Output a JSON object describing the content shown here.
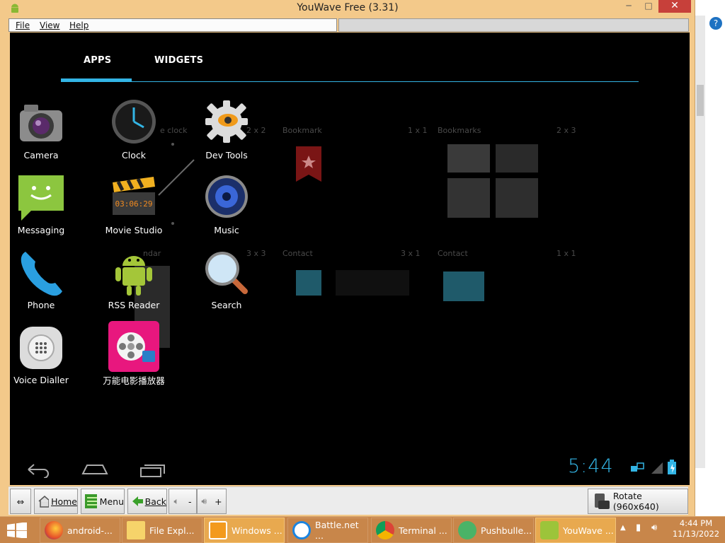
{
  "window": {
    "title": "YouWave Free (3.31)",
    "min": "─",
    "max": "□",
    "close": "✕"
  },
  "menubar": {
    "items": [
      "File",
      "View",
      "Help"
    ]
  },
  "android": {
    "tabs": [
      "APPS",
      "WIDGETS"
    ],
    "apps": [
      {
        "label": "Camera",
        "icon": "camera-icon"
      },
      {
        "label": "Clock",
        "icon": "clock-icon"
      },
      {
        "label": "Dev Tools",
        "icon": "dev-tools-icon"
      },
      {
        "label": "Messaging",
        "icon": "messaging-icon"
      },
      {
        "label": "Movie Studio",
        "icon": "movie-studio-icon"
      },
      {
        "label": "Music",
        "icon": "music-icon"
      },
      {
        "label": "Phone",
        "icon": "phone-icon"
      },
      {
        "label": "RSS Reader",
        "icon": "rss-reader-icon"
      },
      {
        "label": "Search",
        "icon": "search-icon"
      },
      {
        "label": "Voice Dialler",
        "icon": "voice-dialler-icon"
      },
      {
        "label": "万能电影播放器",
        "icon": "video-player-icon"
      }
    ],
    "widget_ghosts": {
      "clock": "e clock",
      "clock_size": "2 x 2",
      "bookmark": "Bookmark",
      "bookmark_size": "1 x 1",
      "bookmarks": "Bookmarks",
      "bookmarks_size": "2 x 3",
      "calendar": "ndar",
      "calendar_size": "3 x 3",
      "contact1": "Contact",
      "contact1_size": "3 x 1",
      "contact2": "Contact",
      "contact2_size": "1 x 1"
    },
    "status_time": "5:44",
    "colors": {
      "accent": "#33b5e5"
    }
  },
  "toolbar": {
    "home": "Home",
    "menu": "Menu",
    "back": "Back",
    "vol_down": "-",
    "vol_up": "+",
    "rotate": "Rotate (960x640)"
  },
  "taskbar": {
    "items": [
      {
        "label": "android-...",
        "icon": "firefox-icon"
      },
      {
        "label": "File Expl...",
        "icon": "file-explorer-icon"
      },
      {
        "label": "Windows ...",
        "icon": "windows-media-icon"
      },
      {
        "label": "Battle.net ...",
        "icon": "battlenet-icon"
      },
      {
        "label": "Terminal ...",
        "icon": "chrome-icon"
      },
      {
        "label": "Pushbulle...",
        "icon": "pushbullet-icon"
      },
      {
        "label": "YouWave ...",
        "icon": "youwave-icon"
      }
    ],
    "time": "4:44 PM",
    "date": "11/13/2022"
  }
}
